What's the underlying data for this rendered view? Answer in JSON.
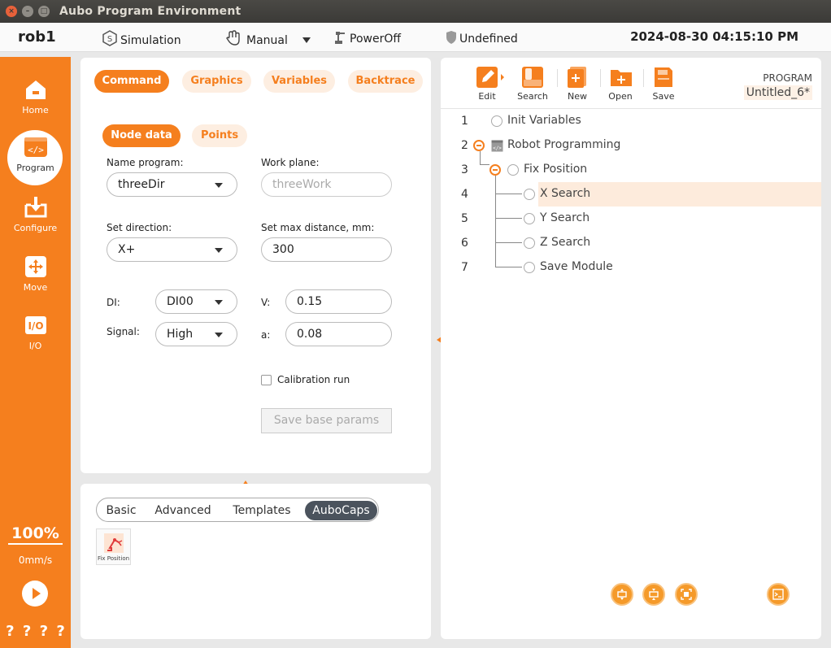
{
  "window": {
    "title": "Aubo Program Environment"
  },
  "statusbar": {
    "robot_name": "rob1",
    "mode": "Simulation",
    "control": "Manual",
    "power": "PowerOff",
    "safety": "Undefined",
    "datetime": "2024-08-30 04:15:10 PM"
  },
  "sidebar": {
    "items": [
      {
        "label": "Home",
        "icon": "home-icon"
      },
      {
        "label": "Program",
        "icon": "code-icon"
      },
      {
        "label": "Configure",
        "icon": "download-icon"
      },
      {
        "label": "Move",
        "icon": "move-arrows-icon"
      },
      {
        "label": "I/O",
        "icon": "io-icon"
      }
    ],
    "speed_percent": "100%",
    "speed_mm": "0mm/s",
    "help": [
      "?",
      "?",
      "?",
      "?"
    ]
  },
  "command_panel": {
    "tabs": [
      "Command",
      "Graphics",
      "Variables",
      "Backtrace"
    ],
    "subtabs": [
      "Node data",
      "Points"
    ],
    "name_program_label": "Name program:",
    "name_program_value": "threeDir",
    "work_plane_label": "Work plane:",
    "work_plane_placeholder": "threeWork",
    "set_direction_label": "Set direction:",
    "set_direction_value": "X+",
    "max_distance_label": "Set max distance, mm:",
    "max_distance_value": "300",
    "di_label": "DI:",
    "di_value": "DI00",
    "v_label": "V:",
    "v_value": "0.15",
    "signal_label": "Signal:",
    "signal_value": "High",
    "a_label": "a:",
    "a_value": "0.08",
    "calibration_label": "Calibration run",
    "calibration_checked": false,
    "save_params_label": "Save base params"
  },
  "library_panel": {
    "tabs": [
      "Basic",
      "Advanced",
      "Templates",
      "AuboCaps"
    ],
    "active_tab": "AuboCaps",
    "tiles": [
      {
        "label": "Fix Position",
        "icon": "robot-arm-icon"
      }
    ]
  },
  "program_panel": {
    "toolbar": [
      {
        "label": "Edit",
        "icon": "edit-icon"
      },
      {
        "label": "Search",
        "icon": "search-icon"
      },
      {
        "label": "New",
        "icon": "new-file-icon"
      },
      {
        "label": "Open",
        "icon": "open-folder-icon"
      },
      {
        "label": "Save",
        "icon": "save-icon"
      }
    ],
    "program_label": "PROGRAM",
    "program_name": "Untitled_6*",
    "tree": [
      {
        "num": "1",
        "label": "Init Variables"
      },
      {
        "num": "2",
        "label": "Robot Programming"
      },
      {
        "num": "3",
        "label": "Fix Position"
      },
      {
        "num": "4",
        "label": "X Search"
      },
      {
        "num": "5",
        "label": "Y Search"
      },
      {
        "num": "6",
        "label": "Z Search"
      },
      {
        "num": "7",
        "label": "Save Module"
      }
    ],
    "bottom_buttons": [
      "expand-vertical-icon",
      "collapse-vertical-icon",
      "fit-view-icon",
      "console-icon"
    ]
  },
  "colors": {
    "accent": "#f57f1e",
    "selected_row": "#fdebdc"
  }
}
